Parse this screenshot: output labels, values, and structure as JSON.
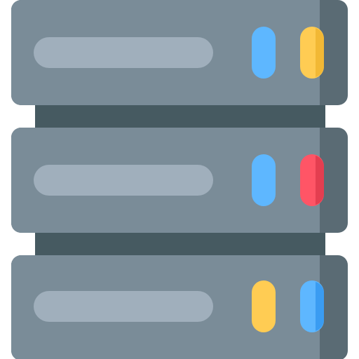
{
  "icon": {
    "name": "server-rack-icon",
    "units": [
      {
        "name": "server-unit-top",
        "leds": [
          "blue",
          "yellow"
        ]
      },
      {
        "name": "server-unit-middle",
        "leds": [
          "blue",
          "red"
        ]
      },
      {
        "name": "server-unit-bottom",
        "leds": [
          "yellow",
          "blue"
        ]
      }
    ]
  },
  "colors": {
    "rack_back": "#465a61",
    "unit_face": "#7a8c98",
    "unit_side": "#5a6b74",
    "slot": "#a0afbc",
    "blue": "#5eb7ff",
    "blue_shadow": "#3a9cf2",
    "yellow": "#ffcc53",
    "yellow_shadow": "#f2b835",
    "red": "#ff5566",
    "red_shadow": "#e43e50"
  }
}
